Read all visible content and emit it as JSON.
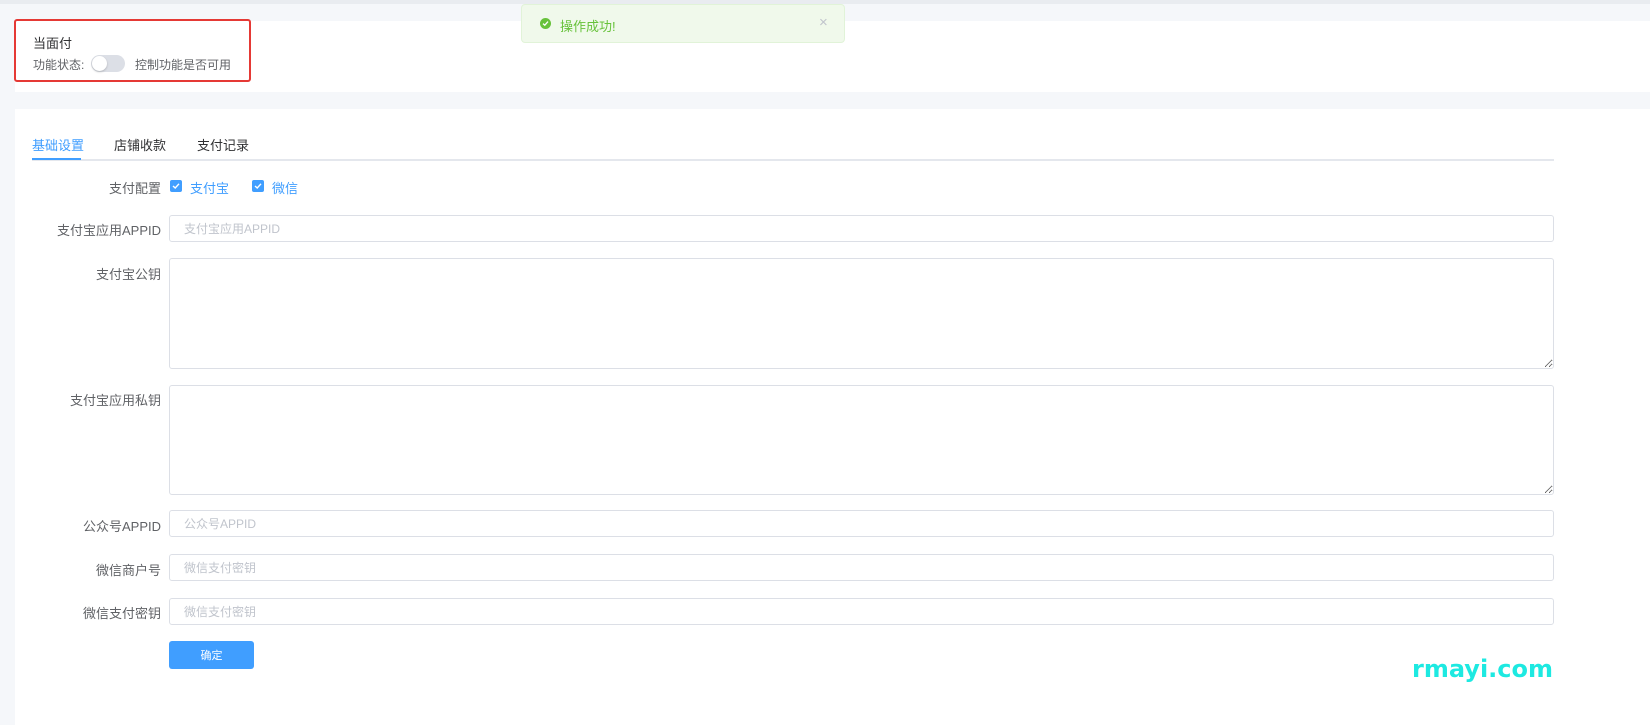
{
  "feature": {
    "title": "当面付",
    "status_label": "功能状态:",
    "switch_enabled": false,
    "switch_description": "控制功能是否可用"
  },
  "toast": {
    "message": "操作成功!",
    "close_symbol": "×",
    "icon": "success-check-icon"
  },
  "tabs": [
    {
      "label": "基础设置",
      "active": true
    },
    {
      "label": "店铺收款",
      "active": false
    },
    {
      "label": "支付记录",
      "active": false
    }
  ],
  "form": {
    "payment_config": {
      "label": "支付配置",
      "options": [
        {
          "label": "支付宝",
          "checked": true
        },
        {
          "label": "微信",
          "checked": true
        }
      ]
    },
    "alipay_appid": {
      "label": "支付宝应用APPID",
      "placeholder": "支付宝应用APPID",
      "value": ""
    },
    "alipay_public_key": {
      "label": "支付宝公钥",
      "value": ""
    },
    "alipay_private_key": {
      "label": "支付宝应用私钥",
      "value": ""
    },
    "mp_appid": {
      "label": "公众号APPID",
      "placeholder": "公众号APPID",
      "value": ""
    },
    "wechat_merchant_id": {
      "label": "微信商户号",
      "placeholder": "微信支付密钥",
      "value": ""
    },
    "wechat_pay_key": {
      "label": "微信支付密钥",
      "placeholder": "微信支付密钥",
      "value": ""
    },
    "submit_label": "确定"
  },
  "watermark": "rmayi.com",
  "colors": {
    "primary": "#409eff",
    "success": "#67c23a",
    "highlight_border": "#e53935",
    "watermark": "#1de9e1"
  }
}
